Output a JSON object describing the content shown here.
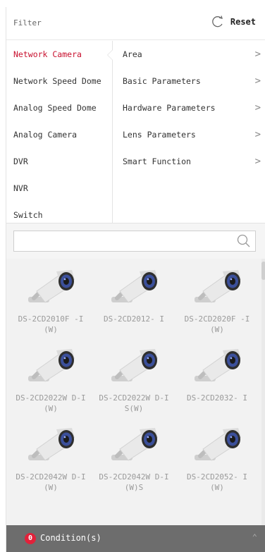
{
  "header": {
    "title": "Filter",
    "reset_label": "Reset"
  },
  "categories": [
    {
      "label": "Network Camera",
      "active": true
    },
    {
      "label": "Network Speed Dome"
    },
    {
      "label": "Analog Speed Dome"
    },
    {
      "label": "Analog Camera"
    },
    {
      "label": "DVR"
    },
    {
      "label": "NVR"
    },
    {
      "label": "Switch"
    }
  ],
  "params": [
    {
      "label": "Area"
    },
    {
      "label": "Basic Parameters"
    },
    {
      "label": "Hardware Parameters"
    },
    {
      "label": "Lens Parameters"
    },
    {
      "label": "Smart Function"
    }
  ],
  "search": {
    "placeholder": "",
    "value": ""
  },
  "products": [
    {
      "model": "DS-2CD2010F -I(W)"
    },
    {
      "model": "DS-2CD2012- I"
    },
    {
      "model": "DS-2CD2020F -I(W)"
    },
    {
      "model": "DS-2CD2022W D-I(W)"
    },
    {
      "model": "DS-2CD2022W D-IS(W)"
    },
    {
      "model": "DS-2CD2032- I"
    },
    {
      "model": "DS-2CD2042W D-I(W)"
    },
    {
      "model": "DS-2CD2042W D-I(W)S"
    },
    {
      "model": "DS-2CD2052- I(W)"
    }
  ],
  "footer": {
    "condition_count": "0",
    "condition_label": "Condition(s)"
  },
  "colors": {
    "accent": "#c8102e",
    "footer_bg": "#6d6d6d",
    "badge": "#e2213a"
  },
  "icons": {
    "reset": "refresh-icon",
    "search": "search-icon",
    "chevron": "chevron-right-icon",
    "collapse": "chevron-up-icon",
    "product": "bullet-camera-icon"
  }
}
